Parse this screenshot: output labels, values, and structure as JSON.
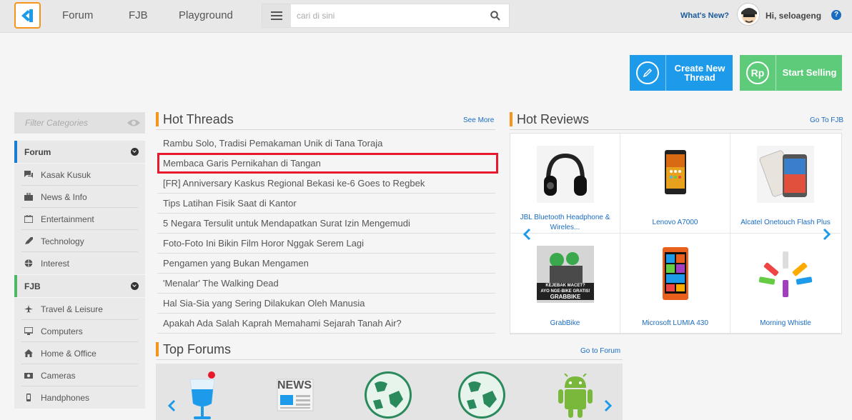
{
  "nav": {
    "items": [
      "Forum",
      "FJB",
      "Playground"
    ],
    "search_placeholder": "cari di sini",
    "whats_new": "What's New?",
    "greeting": "Hi, seloageng",
    "help": "?"
  },
  "actions": {
    "create_line1": "Create New",
    "create_line2": "Thread",
    "create_icon": "pencil-icon",
    "sell_label": "Start Selling",
    "sell_icon_text": "Rp"
  },
  "sidebar": {
    "filter_placeholder": "Filter Categories",
    "forum_label": "Forum",
    "forum_items": [
      "Kasak Kusuk",
      "News & Info",
      "Entertainment",
      "Technology",
      "Interest"
    ],
    "fjb_label": "FJB",
    "fjb_items": [
      "Travel & Leisure",
      "Computers",
      "Home & Office",
      "Cameras",
      "Handphones"
    ]
  },
  "hot_threads": {
    "title": "Hot Threads",
    "link": "See More",
    "items": [
      "Rambu Solo, Tradisi Pemakaman Unik di Tana Toraja",
      "Membaca Garis Pernikahan di Tangan",
      "[FR] Anniversary Kaskus Regional Bekasi ke-6 Goes to Regbek",
      "Tips Latihan Fisik Saat di Kantor",
      "5 Negara Tersulit untuk Mendapatkan Surat Izin Mengemudi",
      "Foto-Foto Ini Bikin Film Horor Nggak Serem Lagi",
      "Pengamen yang Bukan Mengamen",
      "'Menalar' The Walking Dead",
      "Hal Sia-Sia yang Sering Dilakukan Oleh Manusia",
      "Apakah Ada Salah Kaprah Memahami Sejarah Tanah Air?"
    ]
  },
  "hot_reviews": {
    "title": "Hot Reviews",
    "link": "Go To FJB",
    "items": [
      "JBL Bluetooth Headphone & Wireles...",
      "Lenovo A7000",
      "Alcatel Onetouch Flash Plus",
      "GrabBike",
      "Microsoft LUMIA 430",
      "Morning Whistle"
    ],
    "grab_text_1": "KEJEBAK MACET?",
    "grab_text_2": "AYO NGE-BIKE GRATIS!",
    "grab_text_3": "GRABBIKE"
  },
  "top_forums": {
    "title": "Top Forums",
    "link": "Go to Forum",
    "news_label": "NEWS"
  },
  "colors": {
    "accent_orange": "#f7941d",
    "blue": "#1d9bea",
    "green": "#5ecb7a",
    "highlight_red": "#e8192c"
  }
}
